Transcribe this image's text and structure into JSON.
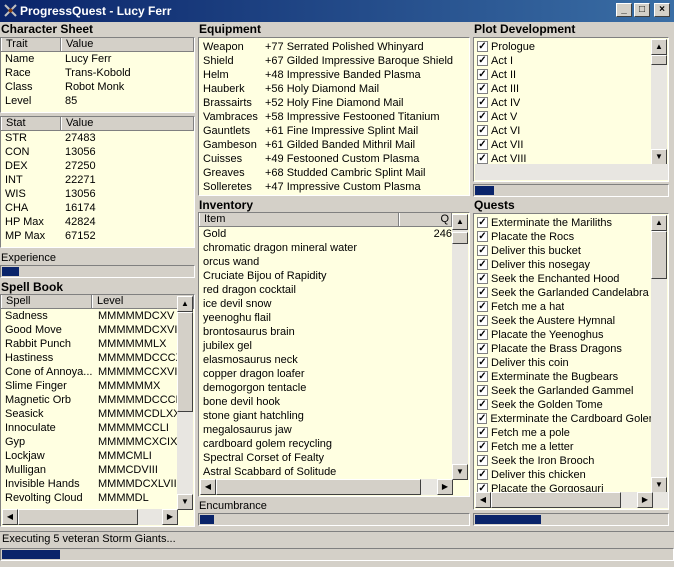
{
  "window": {
    "title": "ProgressQuest - Lucy Ferr"
  },
  "character_sheet": {
    "title": "Character Sheet",
    "headers": [
      "Trait",
      "Value"
    ],
    "traits": [
      {
        "k": "Name",
        "v": "Lucy Ferr"
      },
      {
        "k": "Race",
        "v": "Trans-Kobold"
      },
      {
        "k": "Class",
        "v": "Robot Monk"
      },
      {
        "k": "Level",
        "v": "85"
      }
    ],
    "stat_headers": [
      "Stat",
      "Value"
    ],
    "stats": [
      {
        "k": "STR",
        "v": "27483"
      },
      {
        "k": "CON",
        "v": "13056"
      },
      {
        "k": "DEX",
        "v": "27250"
      },
      {
        "k": "INT",
        "v": "22271"
      },
      {
        "k": "WIS",
        "v": "13056"
      },
      {
        "k": "CHA",
        "v": "16174"
      },
      {
        "k": "HP Max",
        "v": "42824"
      },
      {
        "k": "MP Max",
        "v": "67152"
      }
    ],
    "experience_label": "Experience",
    "experience_progress": 0.1
  },
  "spell_book": {
    "title": "Spell Book",
    "headers": [
      "Spell",
      "Level"
    ],
    "spells": [
      {
        "k": "Sadness",
        "v": "MMMMMDCXV"
      },
      {
        "k": "Good Move",
        "v": "MMMMMDCXVII"
      },
      {
        "k": "Rabbit Punch",
        "v": "MMMMMMLX"
      },
      {
        "k": "Hastiness",
        "v": "MMMMMDCCCXX"
      },
      {
        "k": "Cone of Annoya...",
        "v": "MMMMMCCXVIII"
      },
      {
        "k": "Slime Finger",
        "v": "MMMMMMX"
      },
      {
        "k": "Magnetic Orb",
        "v": "MMMMMDCCCLXX"
      },
      {
        "k": "Seasick",
        "v": "MMMMMCDLXX"
      },
      {
        "k": "Innoculate",
        "v": "MMMMMCCLI"
      },
      {
        "k": "Gyp",
        "v": "MMMMMCXCIX"
      },
      {
        "k": "Lockjaw",
        "v": "MMMCMLI"
      },
      {
        "k": "Mulligan",
        "v": "MMMCDVIII"
      },
      {
        "k": "Invisible Hands",
        "v": "MMMMDCXLVII"
      },
      {
        "k": "Revolting Cloud",
        "v": "MMMMDL"
      }
    ]
  },
  "equipment": {
    "title": "Equipment",
    "items": [
      {
        "k": "Weapon",
        "v": "+77 Serrated Polished Whinyard"
      },
      {
        "k": "Shield",
        "v": "+67 Gilded Impressive Baroque Shield"
      },
      {
        "k": "Helm",
        "v": "+48 Impressive Banded Plasma"
      },
      {
        "k": "Hauberk",
        "v": "+56 Holy Diamond Mail"
      },
      {
        "k": "Brassairts",
        "v": "+52 Holy Fine Diamond Mail"
      },
      {
        "k": "Vambraces",
        "v": "+58 Impressive Festooned Titanium"
      },
      {
        "k": "Gauntlets",
        "v": "+61 Fine Impressive Splint Mail"
      },
      {
        "k": "Gambeson",
        "v": "+61 Gilded Banded Mithril Mail"
      },
      {
        "k": "Cuisses",
        "v": "+49 Festooned Custom Plasma"
      },
      {
        "k": "Greaves",
        "v": "+68 Studded Cambric Splint Mail"
      },
      {
        "k": "Solleretes",
        "v": "+47 Impressive Custom Plasma"
      }
    ]
  },
  "inventory": {
    "title": "Inventory",
    "headers": [
      "Item",
      "Q"
    ],
    "gold_value": "246",
    "items": [
      "Gold",
      "chromatic dragon mineral water",
      "orcus wand",
      "Cruciate Bijou of Rapidity",
      "red dragon cocktail",
      "ice devil snow",
      "yeenoghu flail",
      "brontosaurus brain",
      "jubilex gel",
      "elasmosaurus neck",
      "copper dragon loafer",
      "demogorgon tentacle",
      "bone devil hook",
      "stone giant hatchling",
      "megalosaurus jaw",
      "cardboard golem recycling",
      "Spectral Corset of Fealty",
      "Astral Scabbard of Solitude"
    ],
    "encumbrance_label": "Encumbrance",
    "encumbrance_progress": 0.06
  },
  "plot": {
    "title": "Plot Development",
    "acts": [
      "Prologue",
      "Act I",
      "Act II",
      "Act III",
      "Act IV",
      "Act V",
      "Act VI",
      "Act VII",
      "Act VIII"
    ],
    "progress": 0.11
  },
  "quests": {
    "title": "Quests",
    "items": [
      "Exterminate the Mariliths",
      "Placate the Rocs",
      "Deliver this bucket",
      "Deliver this nosegay",
      "Seek the Enchanted Hood",
      "Seek the Garlanded Candelabra",
      "Fetch me a hat",
      "Seek the Austere Hymnal",
      "Placate the Yeenoghus",
      "Placate the Brass Dragons",
      "Deliver this coin",
      "Exterminate the Bugbears",
      "Seek the Garlanded Gammel",
      "Seek the Golden Tome",
      "Exterminate the Cardboard Golems",
      "Fetch me a pole",
      "Fetch me a letter",
      "Seek the Iron Brooch",
      "Deliver this chicken",
      "Placate the Gorgosauri"
    ],
    "progress": 0.35
  },
  "status": {
    "text": "Executing 5 veteran Storm Giants...",
    "progress": 0.09
  },
  "colors": {
    "list_bg": "#ffffe1",
    "progress_fill": "#0a246a",
    "window_bg": "#d4d0c8"
  }
}
